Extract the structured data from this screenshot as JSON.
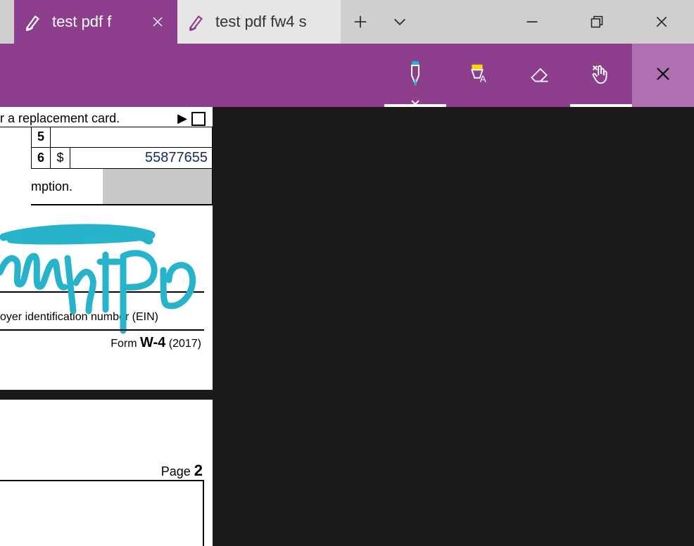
{
  "tabs": [
    {
      "title": "test pdf f",
      "active": true
    },
    {
      "title": "test pdf fw4 s",
      "active": false
    }
  ],
  "form": {
    "replacement_text": "r a replacement card.",
    "row5_num": "5",
    "row6_num": "6",
    "row6_prefix": "$",
    "row6_value": "55877655",
    "exemption_text": "mption.",
    "ein_label": "oyer identification number (EIN)",
    "form_name_prefix": "Form",
    "form_name": "W-4",
    "form_year": "(2017)"
  },
  "page2": {
    "page_word": "Page",
    "page_num": "2"
  },
  "colors": {
    "brand": "#8d3e8d",
    "ink": "#27b3c9"
  }
}
